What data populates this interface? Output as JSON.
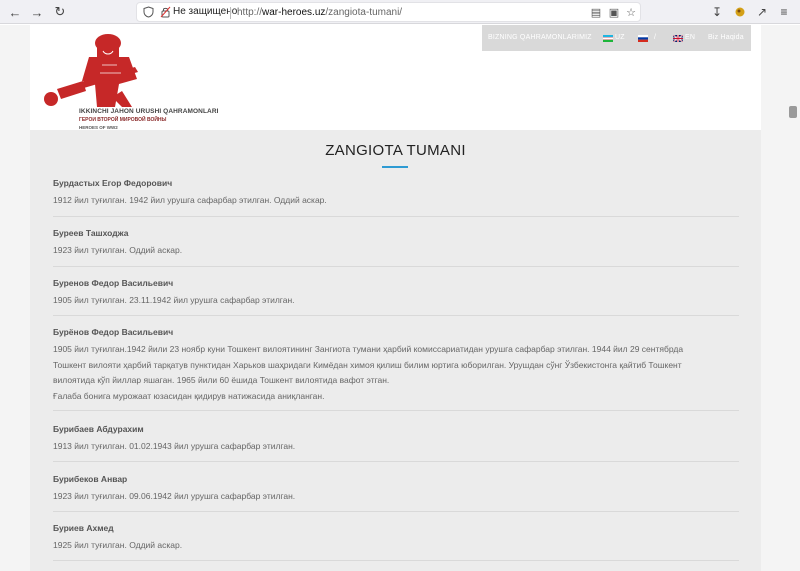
{
  "browser": {
    "security_label": "Не защищено",
    "url_scheme": "http://",
    "url_host": "war-heroes.uz",
    "url_path": "/zangiota-tumani/"
  },
  "site": {
    "logo": {
      "line1": "IKKINCHI JAHON URUSHI QAHRAMONLARI",
      "line2": "ГЕРОИ ВТОРОЙ МИРОВОЙ ВОЙНЫ",
      "line3": "HEROES OF WW2"
    },
    "nav": {
      "heroes": "BIZNING QAHRAMONLARIMIZ",
      "uz": "UZ",
      "ru_sep": "/",
      "en": "EN",
      "about": "Biz Haqida"
    },
    "colors": {
      "accent": "#2e9bd3",
      "logo_red": "#c62828"
    },
    "page_title": "ZANGIOTA TUMANI",
    "entries": [
      {
        "name": "Бурдастых Егор Федорович",
        "text": "1912 йил туғилган. 1942 йил урушга сафарбар этилган. Оддий аскар."
      },
      {
        "name": "Буреев Ташходжа",
        "text": "1923 йил туғилган. Оддий аскар."
      },
      {
        "name": "Буренов Федор Васильевич",
        "text": "1905 йил туғилган. 23.11.1942 йил урушга сафарбар этилган."
      },
      {
        "name": "Бурёнов Федор Васильевич",
        "lines": [
          "1905 йил туғилган.1942 йили 23 ноябр куни Тошкент вилоятининг Зангиота тумани ҳарбий комиссариатидан урушга сафарбар этилган. 1944 йил 29 сентябрда",
          "Тошкент вилояти ҳарбий тарқатув пунктидан Харьков шаҳридаги Кимёдан химоя қилиш билим юртига юборилган. Урушдан сўнг Ўзбекистонга қайтиб Тошкент",
          "вилоятида кўп йиллар яшаган. 1965 йили 60 ёшида Тошкент вилоятида вафот этган.",
          "Ғалаба бонига мурожаат юзасидан қидирув натижасида аниқланган."
        ]
      },
      {
        "name": "Бурибаев Абдурахим",
        "text": "1913 йил туғилган. 01.02.1943 йил урушга сафарбар этилган."
      },
      {
        "name": "Бурибеков Анвар",
        "text": "1923 йил туғилган. 09.06.1942 йил урушга сафарбар этилган."
      },
      {
        "name": "Буриев Ахмед",
        "text": "1925 йил туғилган. Оддий аскар."
      }
    ]
  }
}
